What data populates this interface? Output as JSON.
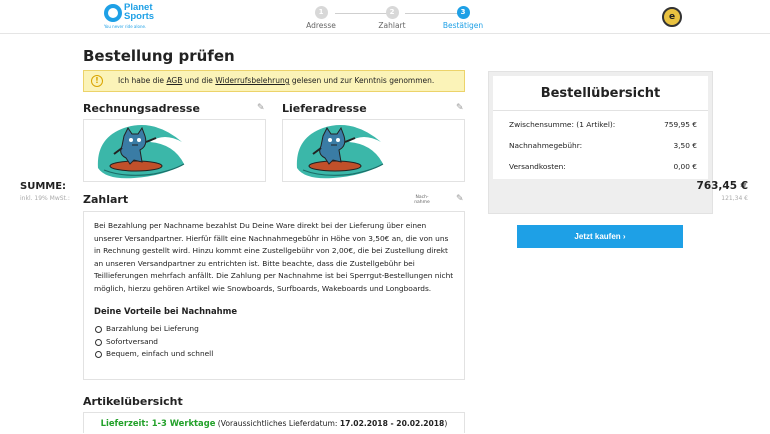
{
  "header": {
    "logo_name": "Planet Sports",
    "logo_tagline": "You never ride alone.",
    "steps": [
      {
        "num": "1",
        "label": "Adresse"
      },
      {
        "num": "2",
        "label": "Zahlart"
      },
      {
        "num": "3",
        "label": "Bestätigen"
      }
    ],
    "trust_badge": "e"
  },
  "page_title": "Bestellung prüfen",
  "notice": {
    "icon": "!",
    "pre": "Ich habe die ",
    "agb": "AGB",
    "mid": " und die ",
    "widerruf": "Widerrufsbelehrung",
    "post": " gelesen und zur Kenntnis genommen."
  },
  "billing": {
    "title": "Rechnungsadresse"
  },
  "shipping": {
    "title": "Lieferadresse"
  },
  "payment": {
    "title": "Zahlart",
    "method_logo": "Nach-nahme",
    "description": "Bei Bezahlung per Nachname bezahlst Du Deine Ware direkt bei der Lieferung über einen unserer Versandpartner. Hierfür fällt eine Nachnahmegebühr in Höhe von 3,50€ an, die von uns in Rechnung gestellt wird. Hinzu kommt eine Zustellgebühr von 2,00€, die bei Zustellung direkt an unseren Versandpartner zu entrichten ist. Bitte beachte, dass die Zustellgebühr bei Teillieferungen mehrfach anfällt. Die Zahlung per Nachnahme ist bei Sperrgut-Bestellungen nicht möglich, hierzu gehören Artikel wie Snowboards, Surfboards, Wakeboards und Longboards.",
    "benefits_title": "Deine Vorteile bei Nachnahme",
    "benefits": [
      "Barzahlung bei Lieferung",
      "Sofortversand",
      "Bequem, einfach und schnell"
    ]
  },
  "articles": {
    "title": "Artikelübersicht",
    "delivery_label": "Lieferzeit: 1-3 Werktage",
    "delivery_pre": " (Voraussichtliches Lieferdatum: ",
    "delivery_dates": "17.02.2018 - 20.02.2018",
    "delivery_post": ")"
  },
  "summary": {
    "title": "Bestellübersicht",
    "rows": [
      {
        "label": "Zwischensumme: (1 Artikel):",
        "value": "759,95 €"
      },
      {
        "label": "Nachnahmegebühr:",
        "value": "3,50 €"
      },
      {
        "label": "Versandkosten:",
        "value": "0,00 €"
      }
    ],
    "total_label": "SUMME:",
    "total_value": "763,45 €",
    "vat_label": "inkl. 19% MwSt.:",
    "vat_value": "121,34 €"
  },
  "buy_button": "Jetzt kaufen",
  "colors": {
    "accent": "#1ea0e6",
    "notice_bg": "#fbf3b8",
    "delivery_green": "#23a12a"
  }
}
